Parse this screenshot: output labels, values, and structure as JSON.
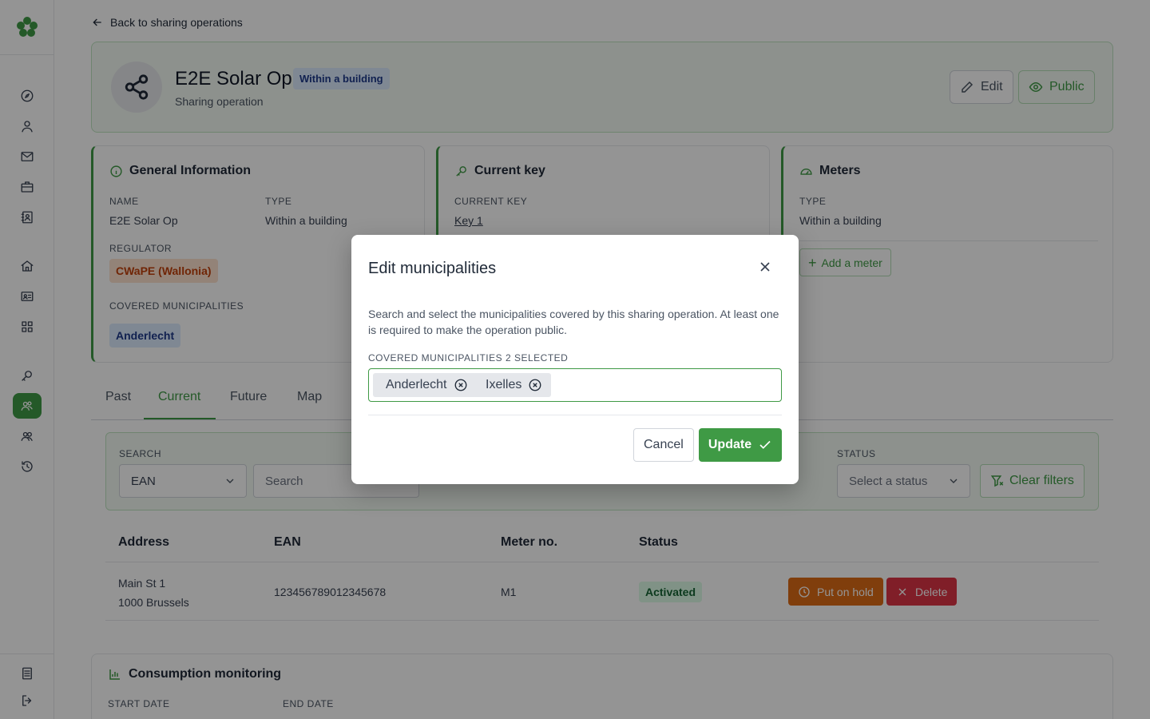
{
  "nav": {
    "back_label": "Back to sharing operations",
    "icons": [
      "compass-icon",
      "user-icon",
      "mail-icon",
      "briefcase-icon",
      "contact-book-icon",
      "home-icon",
      "id-card-icon",
      "grid-icon",
      "search-key-icon",
      "sharing-users-icon",
      "users-icon",
      "history-icon",
      "document-icon",
      "logout-icon"
    ]
  },
  "header": {
    "title": "E2E Solar Op",
    "badge": "Within a building",
    "subtitle": "Sharing operation",
    "edit_label": "Edit",
    "public_label": "Public"
  },
  "general": {
    "title": "General Information",
    "name_label": "NAME",
    "name_value": "E2E Solar Op",
    "type_label": "TYPE",
    "type_value": "Within a building",
    "regulator_label": "REGULATOR",
    "regulator_value": "CWaPE (Wallonia)",
    "municipalities_label": "COVERED MUNICIPALITIES",
    "municipality_value": "Anderlecht"
  },
  "current_key": {
    "title": "Current key",
    "label": "CURRENT KEY",
    "value": "Key 1"
  },
  "meters": {
    "title": "Meters",
    "type_label": "TYPE",
    "type_value": "Within a building",
    "add_label": "Add a meter"
  },
  "tabs": [
    "Past",
    "Current",
    "Future",
    "Map"
  ],
  "filters": {
    "search_label": "SEARCH",
    "search_type": "EAN",
    "search_placeholder": "Search",
    "status_label": "STATUS",
    "status_placeholder": "Select a status",
    "clear_label": "Clear filters"
  },
  "table": {
    "headers": [
      "Address",
      "EAN",
      "Meter no.",
      "Status"
    ],
    "rows": [
      {
        "address_line1": "Main St 1",
        "address_line2": "1000 Brussels",
        "ean": "123456789012345678",
        "meter": "M1",
        "status": "Activated",
        "hold_label": "Put on hold",
        "delete_label": "Delete"
      }
    ]
  },
  "consumption": {
    "title": "Consumption monitoring",
    "start_label": "START DATE",
    "end_label": "END DATE"
  },
  "modal": {
    "title": "Edit municipalities",
    "description": "Search and select the municipalities covered by this sharing operation. At least one is required to make the operation public.",
    "field_label": "COVERED MUNICIPALITIES 2 SELECTED",
    "selected": [
      "Anderlecht",
      "Ixelles"
    ],
    "cancel_label": "Cancel",
    "update_label": "Update"
  },
  "colors": {
    "accent": "#3f9a45",
    "regulator_bg": "#fde2cf",
    "regulator_text": "#c2410c",
    "hold": "#dd6b16",
    "delete": "#dc3545"
  }
}
